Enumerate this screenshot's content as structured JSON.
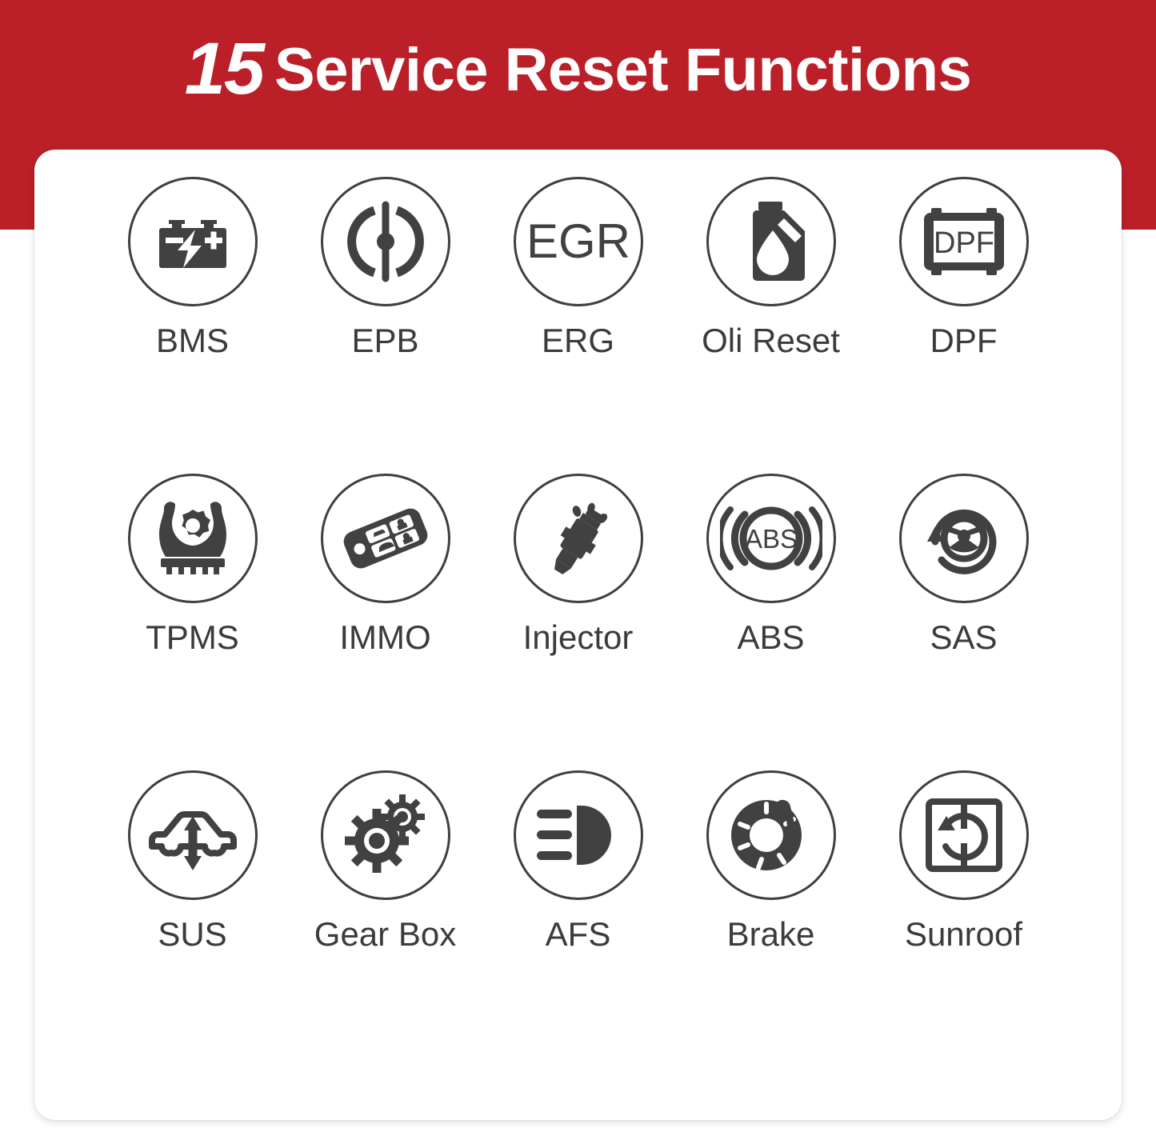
{
  "header": {
    "count": "15",
    "title": "Service Reset Functions",
    "background_color": "#bb2029",
    "text_color": "#ffffff"
  },
  "card": {
    "background_color": "#ffffff",
    "icon_color": "#3f3f3f",
    "label_color": "#3b3b3b"
  },
  "grid": {
    "columns": 5,
    "rows": 3,
    "items": [
      {
        "label": "BMS",
        "icon": "car-battery-icon"
      },
      {
        "label": "EPB",
        "icon": "electronic-parking-brake-icon"
      },
      {
        "label": "ERG",
        "icon": "egr-valve-icon",
        "icon_text": "EGR"
      },
      {
        "label": "Oli Reset",
        "icon": "oil-bottle-icon"
      },
      {
        "label": "DPF",
        "icon": "dpf-filter-icon",
        "icon_text": "DPF"
      },
      {
        "label": "TPMS",
        "icon": "tire-pressure-gear-icon"
      },
      {
        "label": "IMMO",
        "icon": "car-key-fob-icon"
      },
      {
        "label": "Injector",
        "icon": "fuel-injector-spray-icon"
      },
      {
        "label": "ABS",
        "icon": "abs-brake-icon",
        "icon_text": "ABS"
      },
      {
        "label": "SAS",
        "icon": "steering-angle-sensor-icon"
      },
      {
        "label": "SUS",
        "icon": "suspension-car-arrows-icon"
      },
      {
        "label": "Gear Box",
        "icon": "gears-icon"
      },
      {
        "label": "AFS",
        "icon": "headlight-beam-icon"
      },
      {
        "label": "Brake",
        "icon": "brake-disc-caliper-icon"
      },
      {
        "label": "Sunroof",
        "icon": "sunroof-rotate-icon"
      }
    ]
  }
}
